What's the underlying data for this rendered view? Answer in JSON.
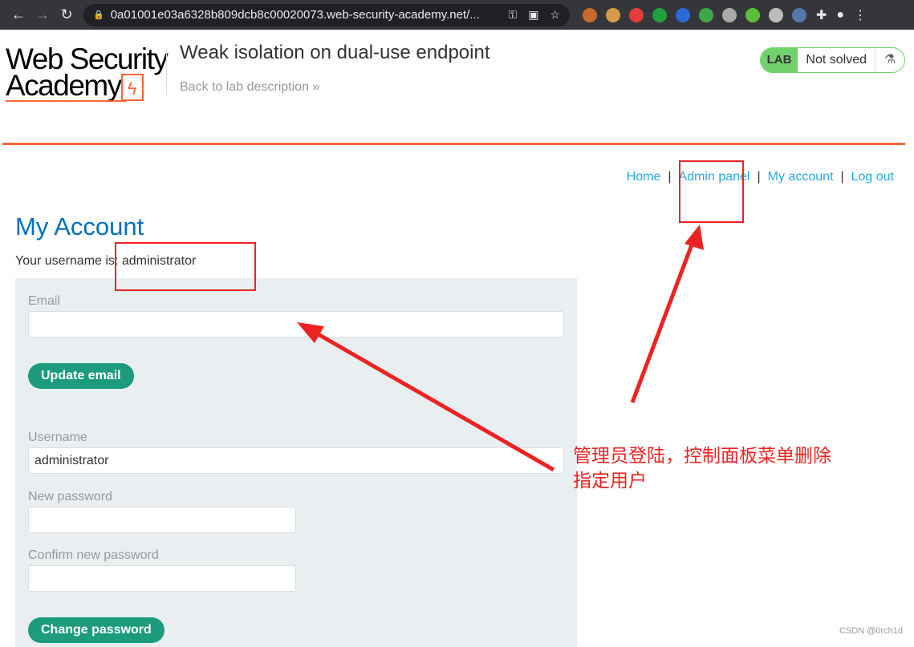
{
  "browser": {
    "url": "0a01001e03a6328b809dcb8c00020073.web-security-academy.net/...",
    "back_icon": "arrow-left",
    "forward_icon": "arrow-right",
    "reload_icon": "reload",
    "extension_colors": [
      "#c96a2a",
      "#d69a4a",
      "#e23c3c",
      "#1fa23a",
      "#2a6ad6",
      "#3ca84a",
      "#aaaaaa",
      "#5bbf3a",
      "#bbbbbb",
      "#5577aa"
    ]
  },
  "header": {
    "logo_text_1": "Web Security",
    "logo_text_2": "Academy",
    "lab_title": "Weak isolation on dual-use endpoint",
    "back_link": "Back to lab description",
    "back_icon": "»",
    "lab_badge": "LAB",
    "status": "Not solved",
    "flask_icon": "⚗"
  },
  "nav": {
    "items": [
      "Home",
      "Admin panel",
      "My account",
      "Log out"
    ],
    "sep": "|"
  },
  "main": {
    "title": "My Account",
    "username_prefix": "Your username is: ",
    "username": "administrator",
    "email_label": "Email",
    "email_value": "",
    "update_email": "Update email",
    "username_label": "Username",
    "username_value": "administrator",
    "new_password_label": "New password",
    "confirm_password_label": "Confirm new password",
    "change_password": "Change password"
  },
  "annotation": {
    "line1": "管理员登陆，控制面板菜单删除",
    "line2": "指定用户",
    "color": "#ee2222"
  },
  "watermark": "CSDN @0rch1d",
  "colors": {
    "accent": "#ff6633",
    "link": "#29a8e0",
    "button": "#1c9c7c",
    "title": "#0071bc"
  }
}
